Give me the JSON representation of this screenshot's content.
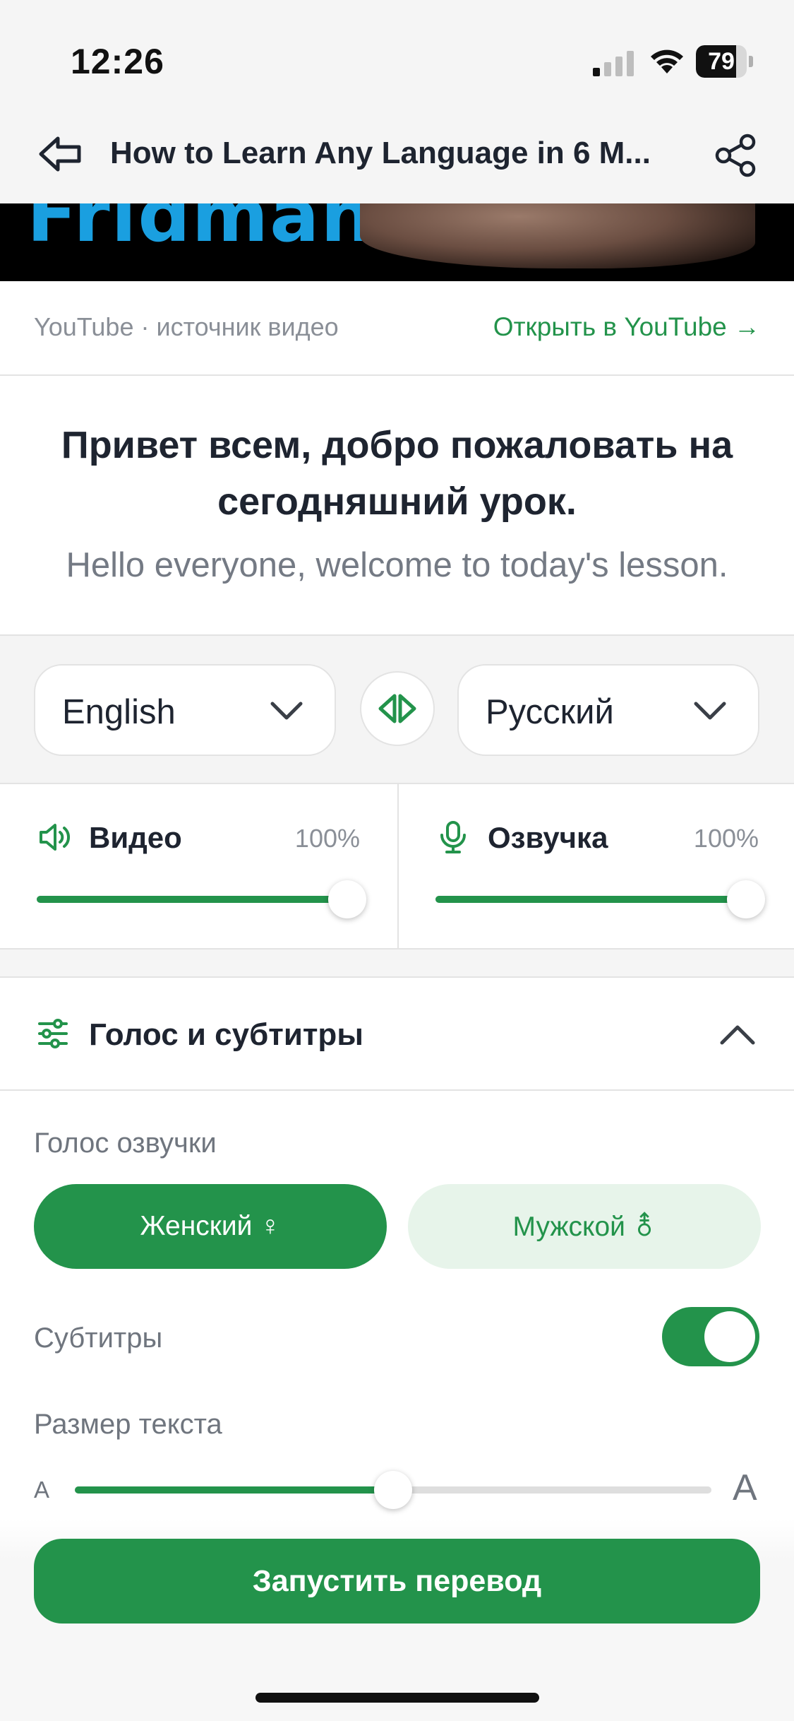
{
  "status_bar": {
    "time": "12:26",
    "battery": "79",
    "battery_level": 0.79
  },
  "header": {
    "title": "How to Learn Any Language in 6 M..."
  },
  "video": {
    "caption_fragment": "Fridman"
  },
  "source": {
    "label": "YouTube · источник видео",
    "open_link": "Открыть в YouTube →"
  },
  "subtitle": {
    "translated": "Привет всем, добро пожаловать на сегодняшний урок.",
    "original": "Hello everyone, welcome to today's lesson."
  },
  "languages": {
    "source": "English",
    "target": "Русский"
  },
  "volume": {
    "video": {
      "label": "Видео",
      "value": "100%",
      "level": 1.0
    },
    "voiceover": {
      "label": "Озвучка",
      "value": "100%",
      "level": 1.0
    }
  },
  "section": {
    "title": "Голос и субтитры"
  },
  "settings": {
    "voice_label": "Голос озвучки",
    "female": "Женский ♀",
    "male": "Мужской ⚨",
    "subtitles_label": "Субтитры",
    "subtitles_on": true,
    "text_size_label": "Размер текста",
    "size_small": "A",
    "size_large": "A",
    "text_size_level": 0.5
  },
  "actions": {
    "start": "Запустить перевод"
  },
  "colors": {
    "accent": "#23934b",
    "accent_light": "#e7f4ea",
    "text": "#1e2430",
    "muted": "#8a8f97"
  },
  "icons": {
    "back": "back-arrow-icon",
    "share": "share-icon",
    "swap": "swap-icon",
    "speaker": "speaker-icon",
    "mic": "microphone-icon",
    "sliders": "sliders-icon",
    "chevron_up": "chevron-up-icon",
    "chevron_down": "chevron-down-icon"
  }
}
